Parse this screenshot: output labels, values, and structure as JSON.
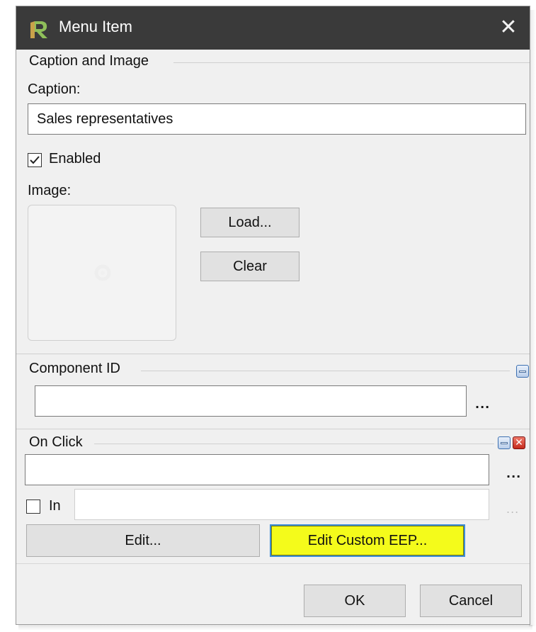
{
  "window": {
    "title": "Menu Item",
    "close_glyph": "✕",
    "icon": "app-logo-icon"
  },
  "caption_section": {
    "header": "Caption and Image",
    "caption_label": "Caption:",
    "caption_value": "Sales representatives",
    "enabled_label": "Enabled",
    "enabled_checked": true,
    "image_label": "Image:",
    "load_label": "Load...",
    "clear_label": "Clear"
  },
  "component_section": {
    "header": "Component ID",
    "value": "",
    "browse_label": "..."
  },
  "onclick_section": {
    "header": "On Click",
    "value": "",
    "browse_label": "...",
    "in_label": "In",
    "in_checked": false,
    "in_value": "",
    "in_browse_label": "...",
    "edit_label": "Edit...",
    "edit_custom_label": "Edit Custom EEP..."
  },
  "footer": {
    "ok_label": "OK",
    "cancel_label": "Cancel"
  },
  "colors": {
    "titlebar": "#3a3a3a",
    "highlight_button": "#f4fb1b",
    "focus_border": "#3c8dd8"
  }
}
